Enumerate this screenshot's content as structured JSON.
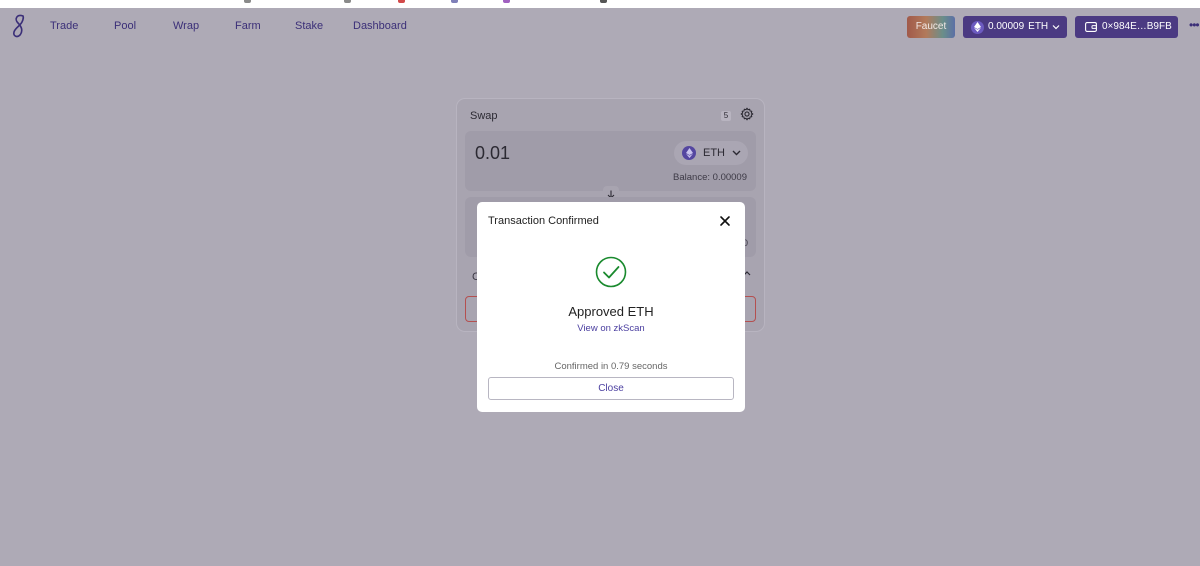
{
  "nav": {
    "items": [
      {
        "label": "Trade"
      },
      {
        "label": "Pool"
      },
      {
        "label": "Wrap"
      },
      {
        "label": "Farm"
      },
      {
        "label": "Stake"
      },
      {
        "label": "Dashboard"
      }
    ]
  },
  "header": {
    "faucet_label": "Faucet",
    "eth_balance": "0.00009",
    "eth_symbol": "ETH",
    "wallet_address": "0×984E…B9FB"
  },
  "swap": {
    "title": "Swap",
    "slippage_badge": "5",
    "from_amount": "0.01",
    "from_token": "ETH",
    "balance_text": "Balance: 0.00009",
    "to_partial_text": "0",
    "info_partial_text": "C"
  },
  "modal": {
    "title": "Transaction Confirmed",
    "approved_text": "Approved ETH",
    "link_text": "View on zkScan",
    "confirmed_text": "Confirmed in 0.79 seconds",
    "close_label": "Close"
  },
  "colors": {
    "accent": "#4b3a82",
    "link": "#4b3fa0",
    "success": "#1a8a2e",
    "overlay": "#aeaab6"
  }
}
